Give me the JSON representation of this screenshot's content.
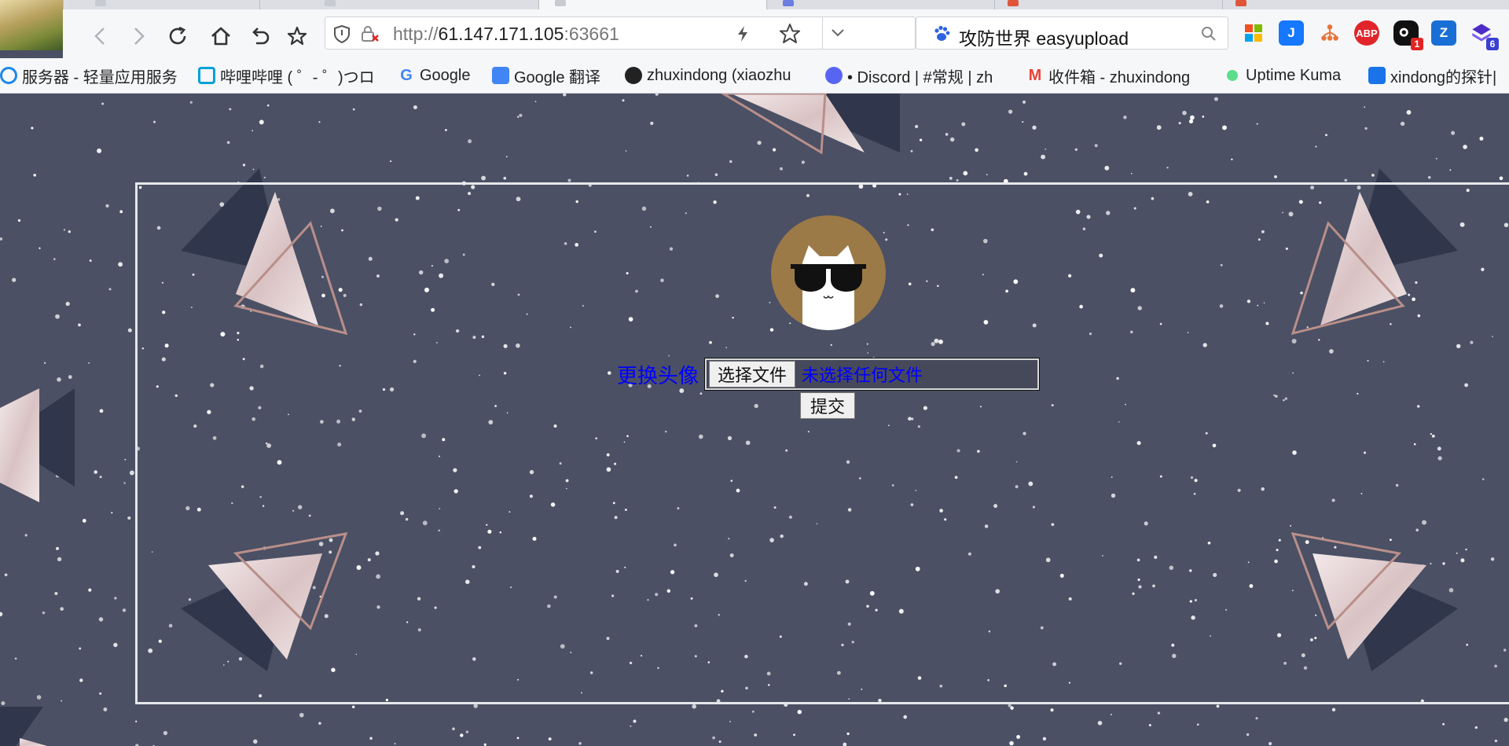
{
  "browser": {
    "url_scheme": "http://",
    "url_host": "61.147.171.105",
    "url_port": ":63661",
    "search_text": "攻防世界 easyupload",
    "extension_badges": {
      "notifications": "1",
      "stack": "6"
    }
  },
  "bookmarks": [
    {
      "label": "服务器 - 轻量应用服务",
      "icon": "cloud-icon",
      "color": "#1e88e5"
    },
    {
      "label": "哔哩哔哩 ( ゜- ゜)つロ",
      "icon": "bilibili-icon",
      "color": "#00a1d6"
    },
    {
      "label": "Google",
      "icon": "google-icon",
      "color": "#4285f4"
    },
    {
      "label": "Google 翻译",
      "icon": "translate-icon",
      "color": "#4285f4"
    },
    {
      "label": "zhuxindong (xiaozhu",
      "icon": "github-icon",
      "color": "#222222"
    },
    {
      "label": "• Discord | #常规 | zh",
      "icon": "discord-icon",
      "color": "#5865f2"
    },
    {
      "label": "收件箱 - zhuxindong",
      "icon": "gmail-icon",
      "color": "#ea4335"
    },
    {
      "label": "Uptime Kuma",
      "icon": "uptime-icon",
      "color": "#5cdd8b"
    },
    {
      "label": "xindong的探针|",
      "icon": "shield-check-icon",
      "color": "#1a73e8"
    }
  ],
  "page": {
    "upload_label": "更换头像",
    "choose_file_button": "选择文件",
    "no_file_text": "未选择任何文件",
    "submit_button": "提交"
  }
}
